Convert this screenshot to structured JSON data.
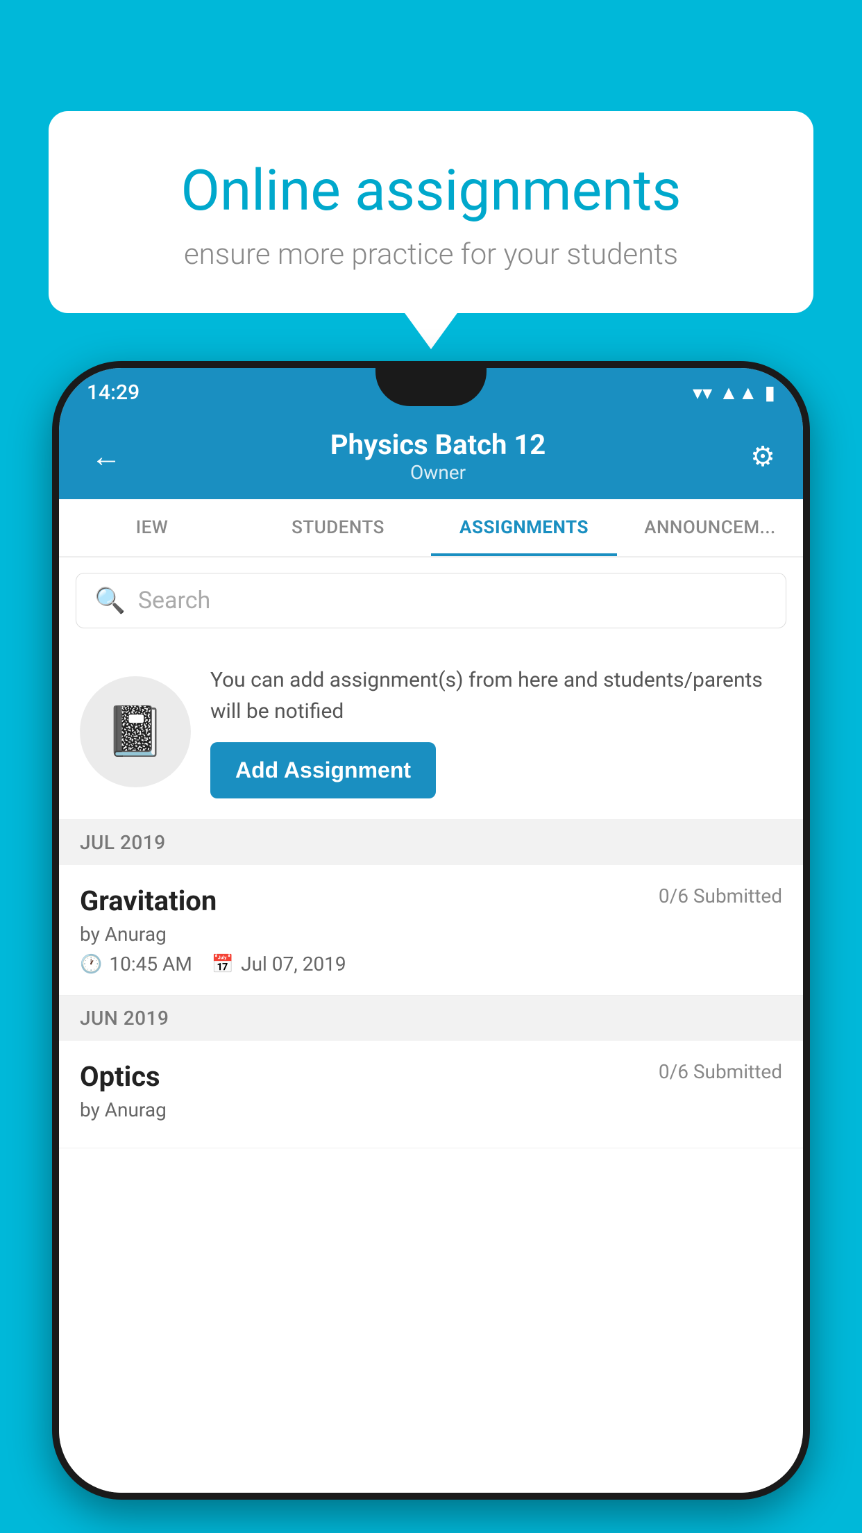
{
  "background": {
    "color": "#00B8D9"
  },
  "speech_bubble": {
    "title": "Online assignments",
    "subtitle": "ensure more practice for your students"
  },
  "phone": {
    "status_bar": {
      "time": "14:29",
      "wifi_icon": "wifi",
      "signal_icon": "signal",
      "battery_icon": "battery"
    },
    "header": {
      "title": "Physics Batch 12",
      "subtitle": "Owner",
      "back_label": "←",
      "settings_label": "⚙"
    },
    "tabs": [
      {
        "label": "IEW",
        "active": false
      },
      {
        "label": "STUDENTS",
        "active": false
      },
      {
        "label": "ASSIGNMENTS",
        "active": true
      },
      {
        "label": "ANNOUNCEM...",
        "active": false
      }
    ],
    "search": {
      "placeholder": "Search"
    },
    "info_card": {
      "description": "You can add assignment(s) from here and students/parents will be notified",
      "button_label": "Add Assignment"
    },
    "assignment_sections": [
      {
        "month": "JUL 2019",
        "assignments": [
          {
            "name": "Gravitation",
            "submitted": "0/6 Submitted",
            "by": "by Anurag",
            "time": "10:45 AM",
            "date": "Jul 07, 2019"
          }
        ]
      },
      {
        "month": "JUN 2019",
        "assignments": [
          {
            "name": "Optics",
            "submitted": "0/6 Submitted",
            "by": "by Anurag",
            "time": "",
            "date": ""
          }
        ]
      }
    ]
  }
}
